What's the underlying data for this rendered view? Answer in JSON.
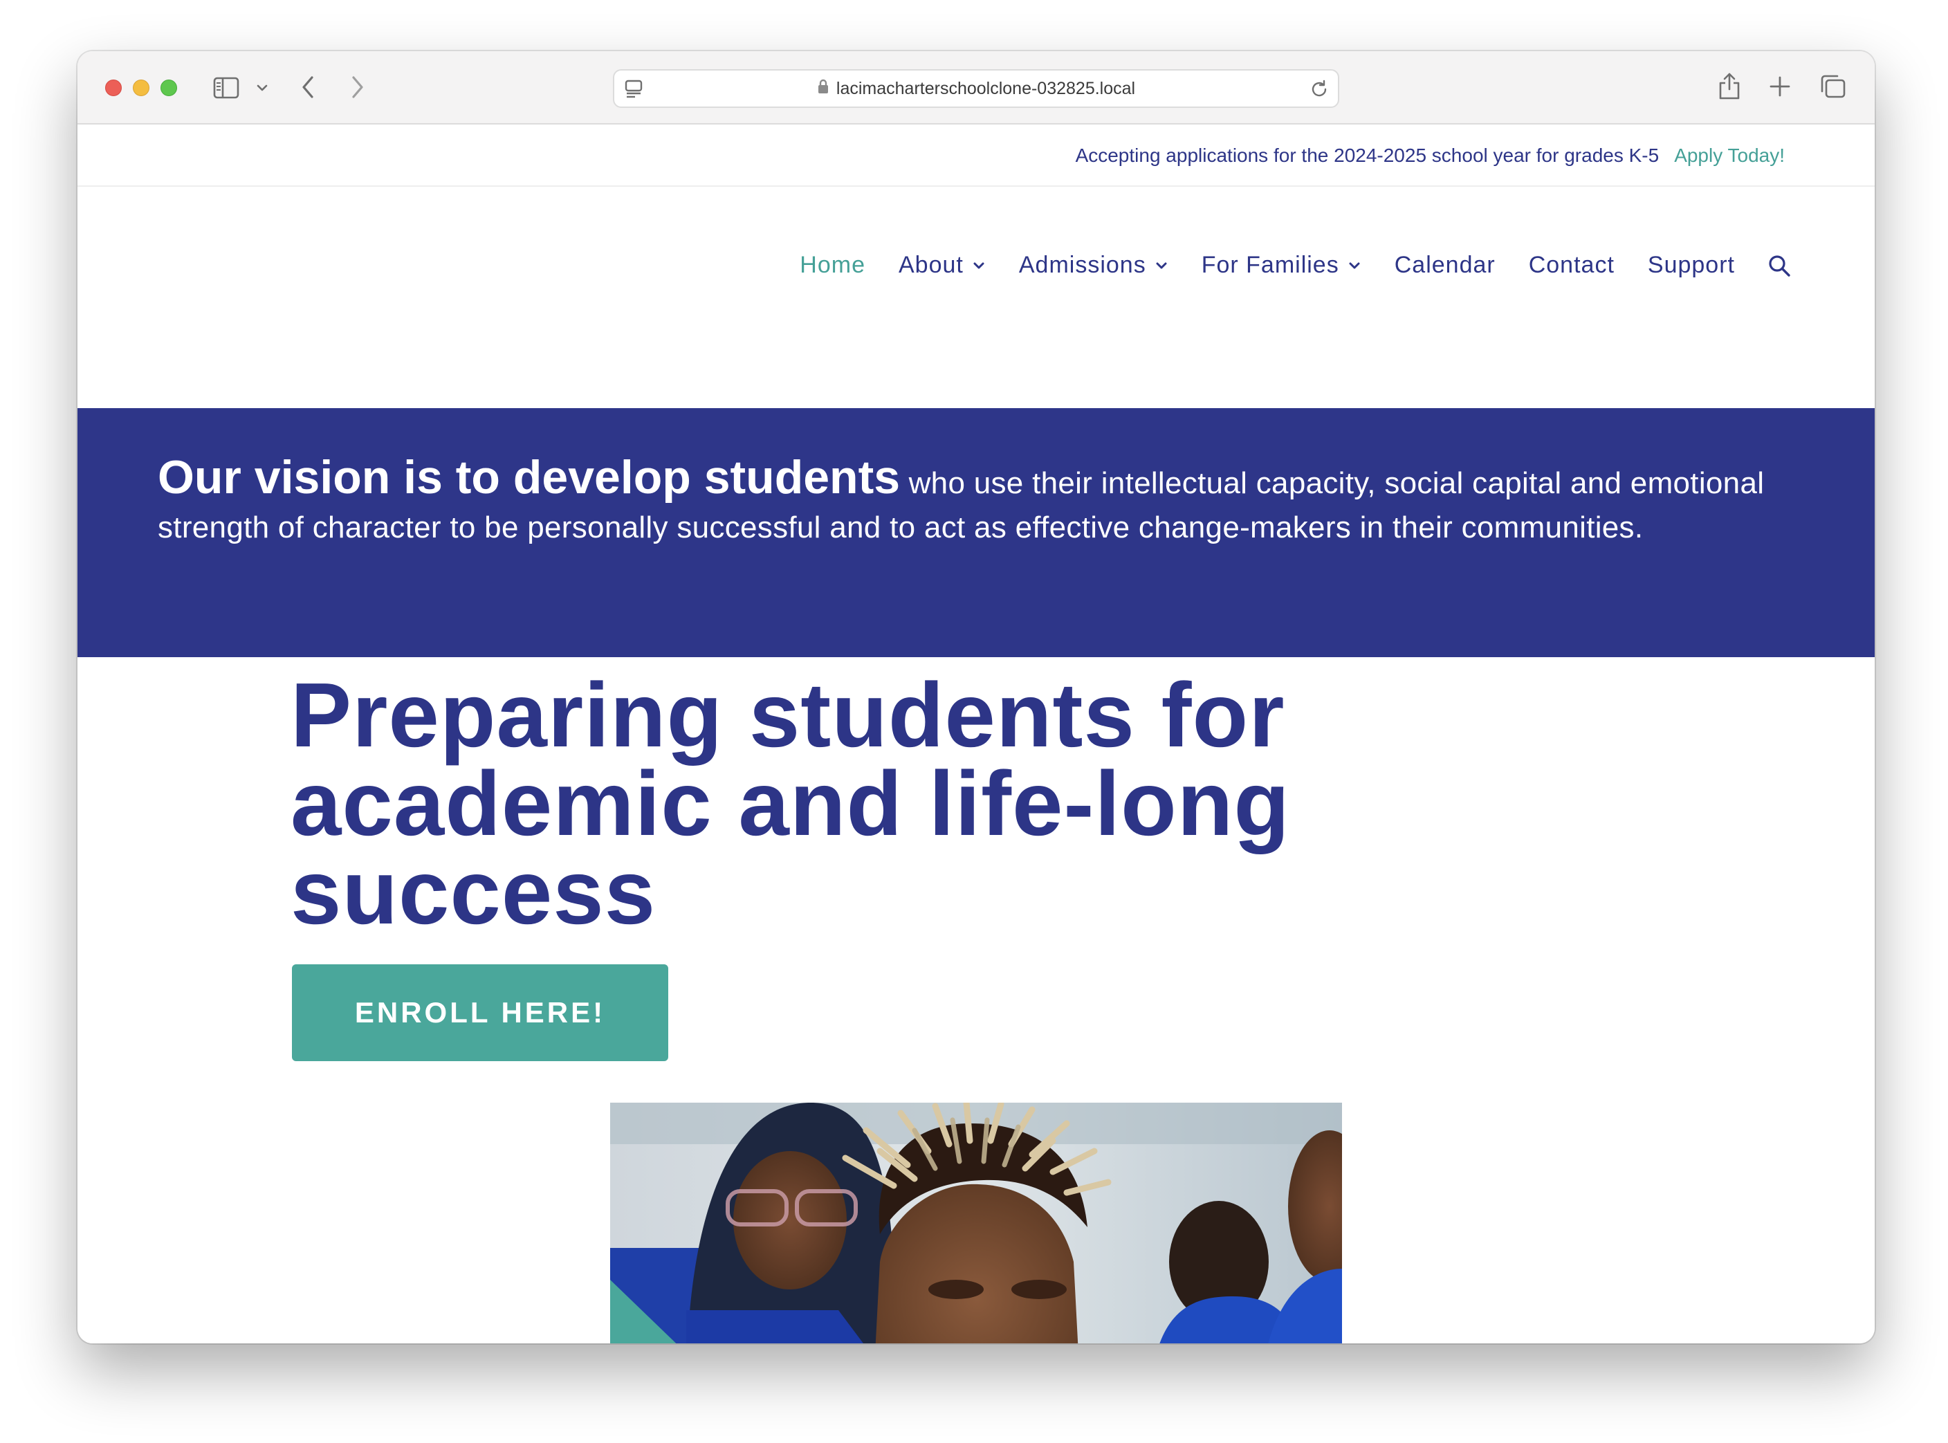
{
  "browser": {
    "url": "lacimacharterschoolclone-032825.local",
    "icons": [
      "sidebar-icon",
      "chevron-down-icon",
      "back-icon",
      "forward-icon",
      "reader-icon",
      "lock-icon",
      "reload-icon",
      "share-icon",
      "new-tab-icon",
      "tabs-overview-icon"
    ]
  },
  "topbar": {
    "message": "Accepting applications for the 2024-2025 school year for grades K-5",
    "link": "Apply Today!"
  },
  "nav": {
    "items": [
      {
        "label": "Home",
        "active": true,
        "dropdown": false
      },
      {
        "label": "About",
        "active": false,
        "dropdown": true
      },
      {
        "label": "Admissions",
        "active": false,
        "dropdown": true
      },
      {
        "label": "For Families",
        "active": false,
        "dropdown": true
      },
      {
        "label": "Calendar",
        "active": false,
        "dropdown": false
      },
      {
        "label": "Contact",
        "active": false,
        "dropdown": false
      },
      {
        "label": "Support",
        "active": false,
        "dropdown": false
      }
    ],
    "search_icon": "search-icon"
  },
  "vision": {
    "strong": "Our vision is to develop students",
    "rest": "who use their intellectual capacity, social capital and emotional strength of character to be personally successful and to act as effective change-makers in their communities."
  },
  "hero": {
    "title": "Preparing students for academic and life-long success",
    "button": "ENROLL HERE!"
  },
  "colors": {
    "navy": "#2e3689",
    "teal": "#4aa79b",
    "nav_text": "#2d3587"
  }
}
